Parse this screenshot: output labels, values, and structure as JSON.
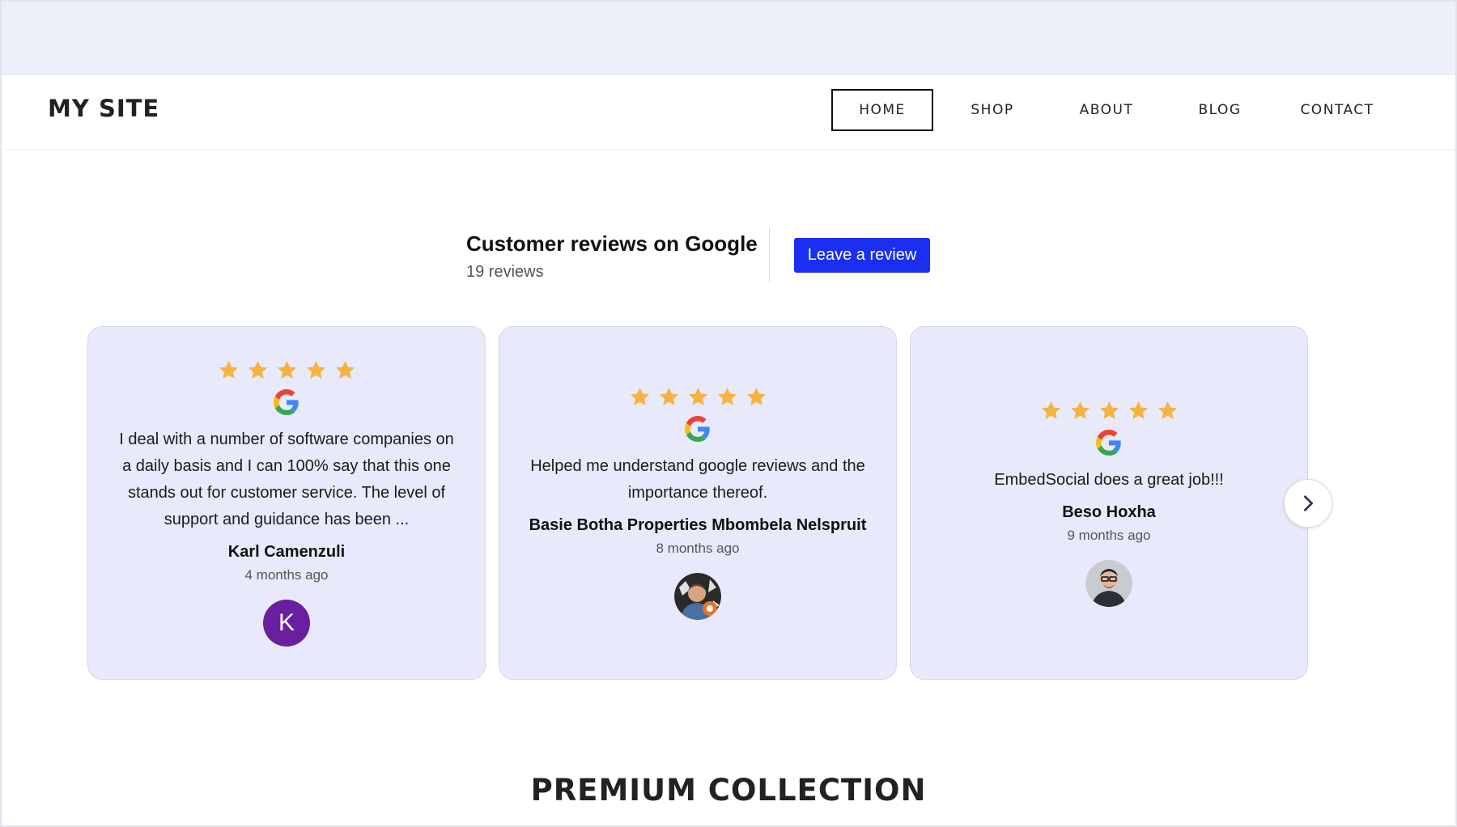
{
  "site": {
    "logo": "MY SITE"
  },
  "nav": {
    "items": [
      "HOME",
      "SHOP",
      "ABOUT",
      "BLOG",
      "CONTACT"
    ],
    "active": "HOME"
  },
  "reviews_header": {
    "title": "Customer reviews on Google",
    "count": "19 reviews",
    "cta": "Leave a review"
  },
  "reviews": [
    {
      "rating": 5,
      "text": "I deal with a number of software companies on a daily basis and I can 100% say that this one stands out for customer service. The level of support and guidance has been ...",
      "author": "Karl Camenzuli",
      "date": "4 months ago",
      "avatar_initial": "K"
    },
    {
      "rating": 5,
      "text": "Helped me understand google reviews and the importance thereof.",
      "author": "Basie Botha Properties Mbombela Nelspruit",
      "date": "8 months ago",
      "avatar_initial": ""
    },
    {
      "rating": 5,
      "text": "EmbedSocial does a great job!!!",
      "author": "Beso Hoxha",
      "date": "9 months ago",
      "avatar_initial": ""
    }
  ],
  "carousel": {
    "next_icon": "chevron-right-icon"
  },
  "section": {
    "title": "PREMIUM COLLECTION"
  },
  "colors": {
    "accent": "#1a2ff0",
    "star": "#f5b342",
    "card_bg": "#e8eafb",
    "top_band": "#ecf0f9"
  }
}
